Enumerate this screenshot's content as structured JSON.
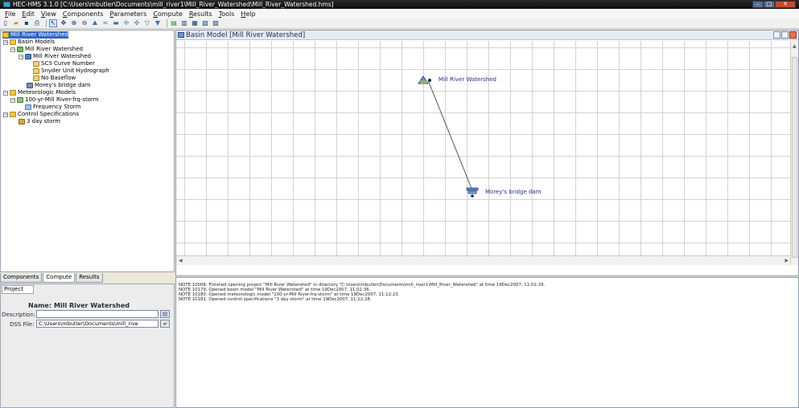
{
  "window": {
    "title": "HEC-HMS 3.1.0 [C:\\Users\\mbutler\\Documents\\mill_river1\\Mill_River_Watershed\\Mill_River_Watershed.hms]"
  },
  "menu": [
    "File",
    "Edit",
    "View",
    "Components",
    "Parameters",
    "Compute",
    "Results",
    "Tools",
    "Help"
  ],
  "toolbar": {
    "buttons": [
      "new-icon",
      "open-icon",
      "save-icon",
      "print-icon",
      "arrow-select-icon",
      "pan-icon",
      "zoom-in-icon",
      "zoom-out-icon",
      "subbasin-tool-icon",
      "reach-tool-icon",
      "reservoir-tool-icon",
      "junction-tool-icon",
      "diversion-tool-icon",
      "source-tool-icon",
      "sink-tool-icon",
      "compute-icon",
      "results-graph-icon",
      "results-table-icon",
      "summary-icon",
      "print-results-icon"
    ]
  },
  "tree": {
    "root": "Mill River Watershed",
    "basin_models": "Basin Models",
    "basin_model": "Mill River Watershed",
    "subbasin": "Mill River Watershed",
    "loss": "SCS Curve Number",
    "transform": "Snyder Unit Hydrograph",
    "baseflow": "No Baseflow",
    "reservoir": "Morey's bridge dam",
    "met_models": "Meteorologic Models",
    "met_model": "100-yr-Mill River-frq-storm",
    "precip": "Frequency Storm",
    "control_specs": "Control Specifications",
    "control": "3 day storm"
  },
  "tabs": [
    "Components",
    "Compute",
    "Results"
  ],
  "properties": {
    "tab": "Project",
    "name_label": "Name:",
    "name_value": "Mill River Watershed",
    "description_label": "Description:",
    "description_value": "",
    "dss_label": "DSS File:",
    "dss_value": "C:\\Users\\mbutler\\Documents\\mill_rive"
  },
  "basin": {
    "title": "Basin Model [Mill River Watershed]",
    "elements": [
      {
        "name": "Mill River Watershed",
        "icon": "subbasin-icon"
      },
      {
        "name": "Morey's bridge dam",
        "icon": "reservoir-icon"
      }
    ]
  },
  "log": [
    "NOTE 10008:  Finished opening project \"Mill River Watershed\" in directory \"C:\\Users\\mbutler\\Documents\\mill_river1\\Mill_River_Watershed\" at time 19Dec2007, 11:02:29.",
    "NOTE 10179:  Opened basin model \"Mill River Watershed\" at time 19Dec2007, 11:02:36.",
    "NOTE 10180:  Opened meteorologic model \"100-yr-Mill River-frq-storm\" at time 19Dec2007, 11:12:23.",
    "NOTE 10181:  Opened control specifications \"3 day storm\" at time 19Dec2007, 11:12:28."
  ]
}
